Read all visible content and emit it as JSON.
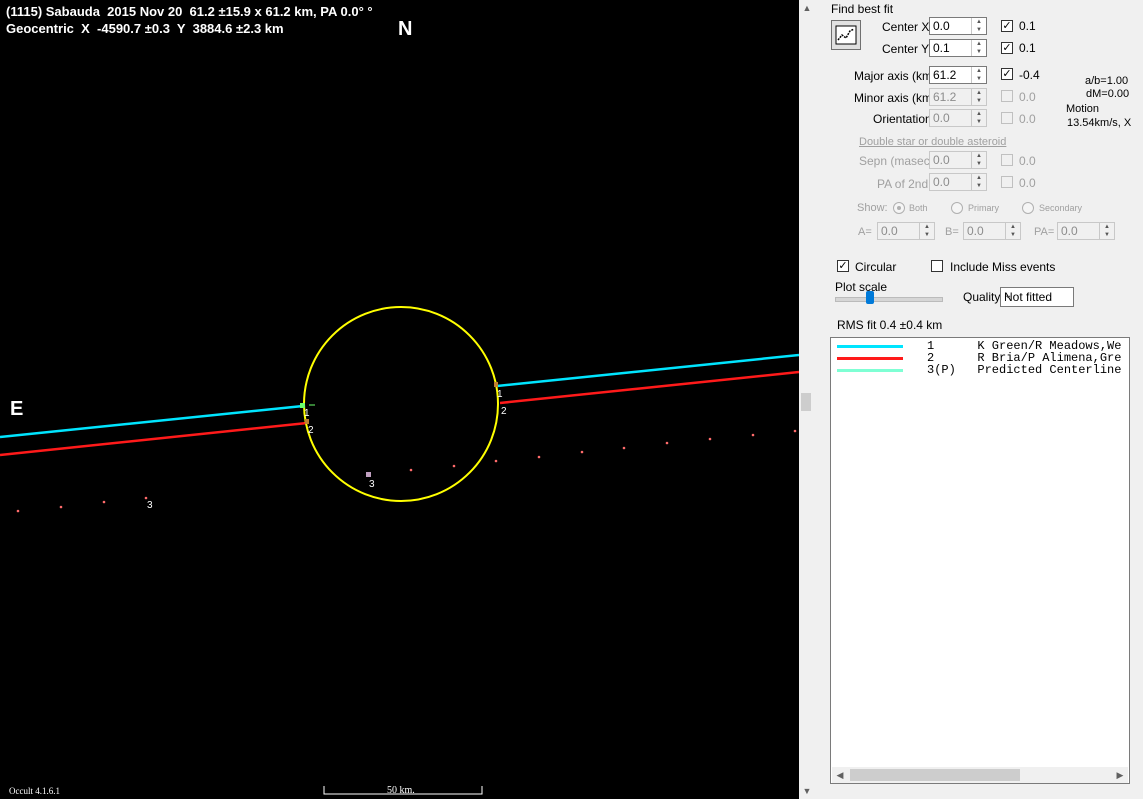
{
  "plot": {
    "title_line1": "(1115) Sabauda  2015 Nov 20  61.2 ±15.9 x 61.2 km, PA 0.0° °",
    "title_line2": "Geocentric  X  -4590.7 ±0.3  Y  3884.6 ±2.3 km",
    "north": "N",
    "east": "E",
    "version": "Occult 4.1.6.1",
    "scale_label": "50 km.",
    "chord_labels": [
      "1",
      "2",
      "1",
      "2",
      "3",
      "3"
    ],
    "colors": {
      "ellipse": "#ffff00",
      "chord1": "#00e5ff",
      "chord2": "#ff1a1a",
      "predicted": "#ff6b6b"
    }
  },
  "panel": {
    "find_best_fit": "Find best fit",
    "fit_button_icon": "chart-fit-icon",
    "center_x_label": "Center X",
    "center_x_value": "0.0",
    "center_x_step": "0.1",
    "center_y_label": "Center Y",
    "center_y_value": "0.1",
    "center_y_step": "0.1",
    "major_axis_label": "Major axis (km)",
    "major_axis_value": "61.2",
    "major_axis_step": "-0.4",
    "minor_axis_label": "Minor axis (km)",
    "minor_axis_value": "61.2",
    "minor_axis_step": "0.0",
    "orientation_label": "Orientation",
    "orientation_value": "0.0",
    "orientation_step": "0.0",
    "ab_ratio": "a/b=1.00",
    "dm": "dM=0.00",
    "motion_label": "Motion",
    "motion_value": "13.54km/s, X",
    "double_star_link": "Double star  or  double asteroid",
    "sepn_label": "Sepn (masec)",
    "sepn_value": "0.0",
    "sepn_step": "0.0",
    "pa2_label": "PA of 2nd",
    "pa2_value": "0.0",
    "pa2_step": "0.0",
    "show_label": "Show:",
    "show_both": "Both",
    "show_primary": "Primary",
    "show_secondary": "Secondary",
    "a_label": "A=",
    "a_value": "0.0",
    "b_label": "B=",
    "b_value": "0.0",
    "pa_label": "PA=",
    "pa_value": "0.0",
    "circular_label": "Circular",
    "include_miss_label": "Include Miss events",
    "plot_scale_label": "Plot scale",
    "plot_scale_level": 0.3,
    "quality_label": "Quality",
    "quality_value": "Not fitted",
    "rms_fit": "RMS fit 0.4 ±0.4 km",
    "legend": [
      {
        "text": "1      K Green/R Meadows,We",
        "color": "#00e5ff"
      },
      {
        "text": "2      R Bria/P Alimena,Gre",
        "color": "#ff1a1a"
      },
      {
        "text": "3(P)   Predicted Centerline",
        "color": "#7fffd4"
      }
    ]
  }
}
